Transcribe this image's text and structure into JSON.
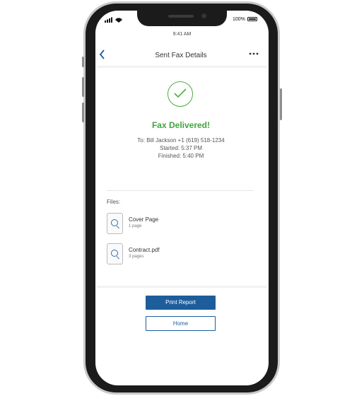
{
  "status_bar": {
    "battery": "100%"
  },
  "clock": "9:41 AM",
  "nav": {
    "back_icon": "chevron-left-icon",
    "title": "Sent Fax Details",
    "more_icon": "more-horizontal-icon"
  },
  "result": {
    "icon": "checkmark-circle-icon",
    "headline": "Fax Delivered!",
    "to": "To: Bill Jackson +1 (619) 518-1234",
    "started": "Started: 5:37 PM",
    "finished": "Finished: 5:40 PM"
  },
  "files": {
    "label": "Files:",
    "items": [
      {
        "name": "Cover Page",
        "pages": "1 page",
        "icon": "document-magnifier-icon"
      },
      {
        "name": "Contract.pdf",
        "pages": "3 pages",
        "icon": "document-magnifier-icon"
      }
    ]
  },
  "actions": {
    "print_label": "Print Report",
    "home_label": "Home"
  },
  "colors": {
    "accent": "#1d5d9c",
    "success": "#3fa63a"
  }
}
